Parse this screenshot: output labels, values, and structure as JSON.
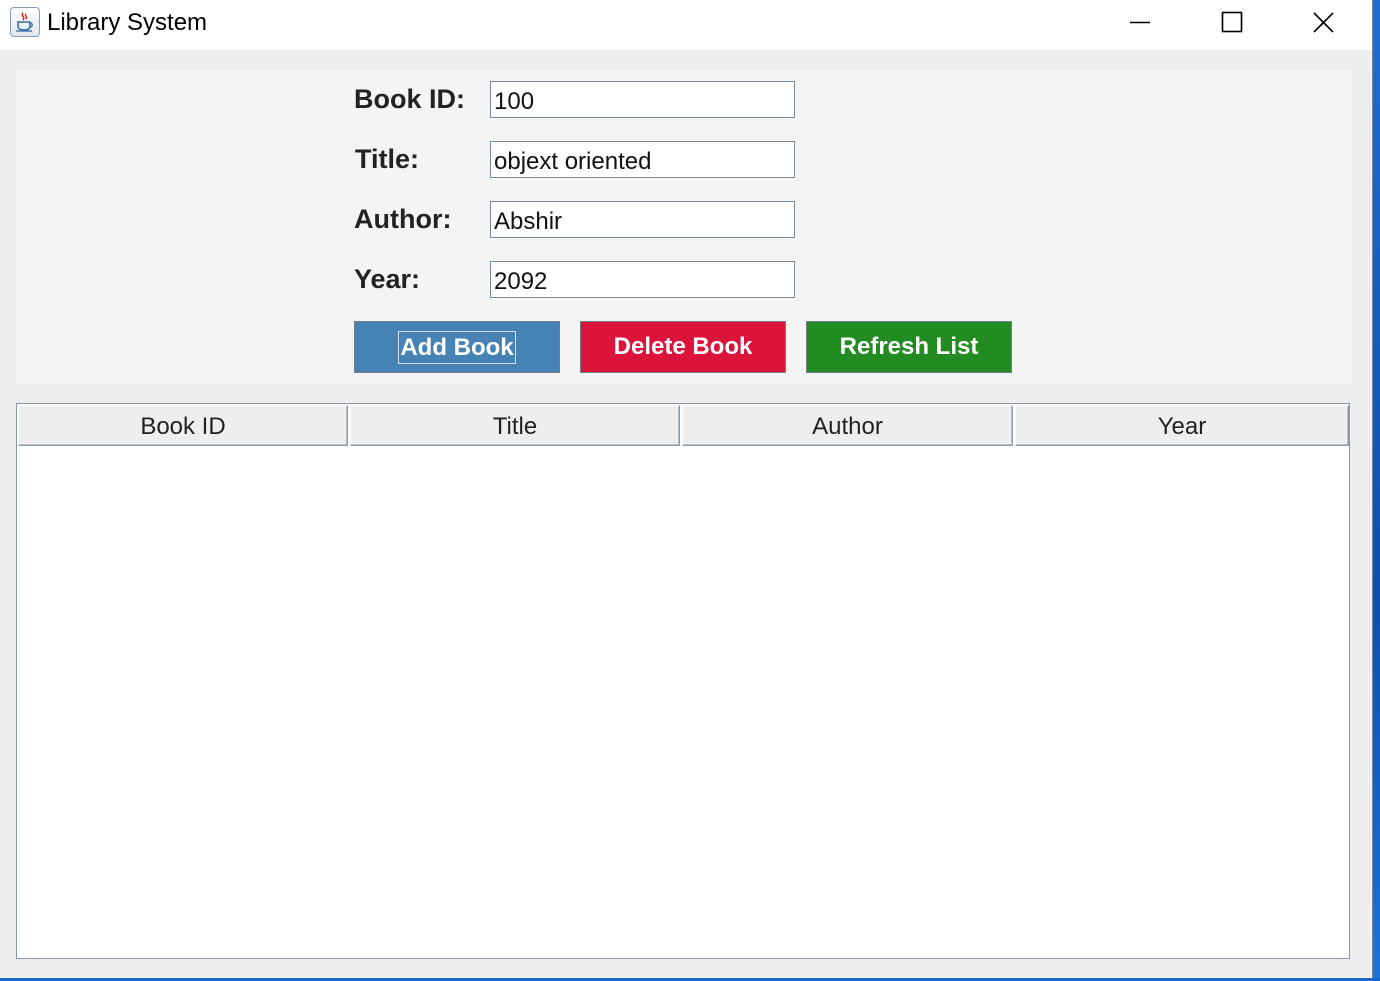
{
  "window": {
    "title": "Library System"
  },
  "icons": {
    "app": "java-cup-icon",
    "minimize": "minimize-icon",
    "maximize": "maximize-icon",
    "close": "close-icon"
  },
  "form": {
    "fields": [
      {
        "label": "Book ID:",
        "value": "100"
      },
      {
        "label": "Title:",
        "value": "objext oriented"
      },
      {
        "label": "Author:",
        "value": "Abshir"
      },
      {
        "label": "Year:",
        "value": "2092"
      }
    ],
    "buttons": {
      "add": {
        "label": "Add Book",
        "color": "#4682b4"
      },
      "delete": {
        "label": "Delete Book",
        "color": "#dc143c"
      },
      "refresh": {
        "label": "Refresh List",
        "color": "#228b22"
      }
    }
  },
  "table": {
    "columns": [
      "Book ID",
      "Title",
      "Author",
      "Year"
    ],
    "rows": []
  }
}
